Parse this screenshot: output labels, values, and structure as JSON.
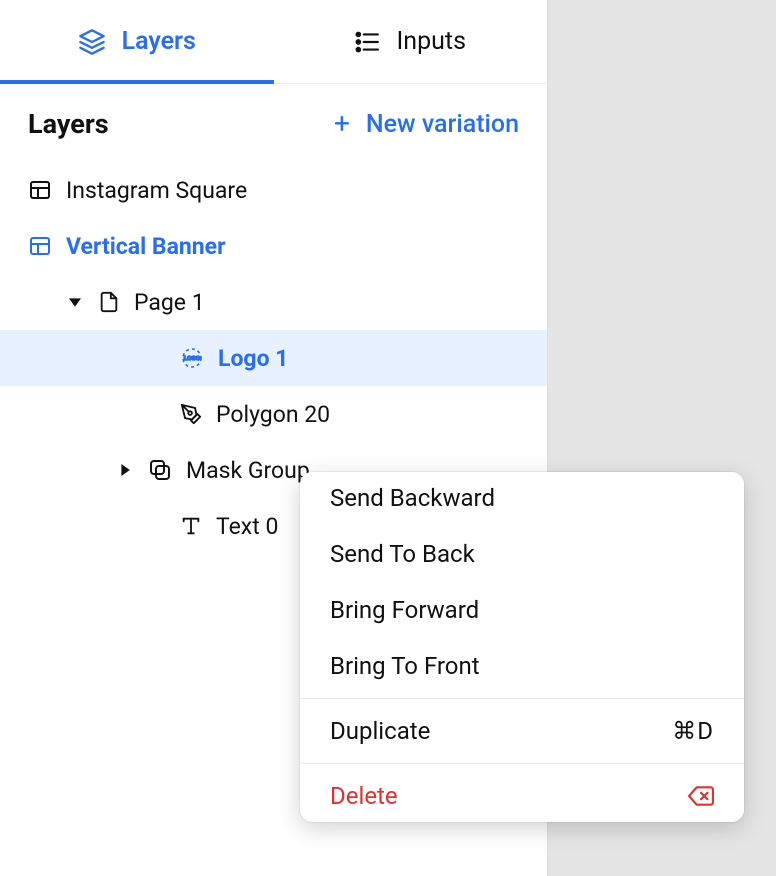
{
  "tabs": {
    "layers": "Layers",
    "inputs": "Inputs"
  },
  "section": {
    "title": "Layers",
    "newVariation": "New variation"
  },
  "tree": {
    "doc0": "Instagram Square",
    "doc1": "Vertical Banner",
    "page1": "Page 1",
    "logo1": "Logo 1",
    "polygon20": "Polygon 20",
    "maskGroup": "Mask Group",
    "text0": "Text 0"
  },
  "contextMenu": {
    "sendBackward": "Send Backward",
    "sendToBack": "Send To Back",
    "bringForward": "Bring Forward",
    "bringToFront": "Bring To Front",
    "duplicate": "Duplicate",
    "duplicateShortcut": "⌘D",
    "delete": "Delete"
  }
}
